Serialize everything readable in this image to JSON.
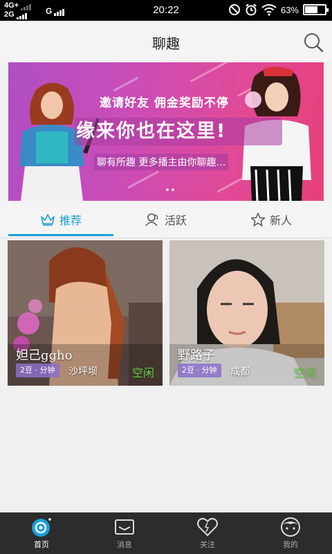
{
  "status_bar": {
    "network_top": "4G+",
    "network_bottom": "2G",
    "network_g": "G",
    "time": "20:22",
    "battery": "63%",
    "battery_level": 0.63
  },
  "header": {
    "title": "聊趣",
    "search_icon": "search-icon"
  },
  "banner": {
    "line1": "邀请好友  佣金奖励不停",
    "line2": "缘来你也在这里!",
    "line3": "聊有所趣 更多播主由你聊趣…",
    "colors": {
      "from": "#b04fc4",
      "to": "#e8407a"
    }
  },
  "tabs": [
    {
      "label": "推荐",
      "icon": "crown-icon",
      "active": true
    },
    {
      "label": "活跃",
      "icon": "users-icon",
      "active": false
    },
    {
      "label": "新人",
      "icon": "star-icon",
      "active": false
    }
  ],
  "cards": [
    {
      "name": "妲己ggho",
      "price": "2豆 · 分钟",
      "location": "沙坪坝",
      "status": "空闲"
    },
    {
      "name": "野路子",
      "price": "2豆 · 分钟",
      "location": "成都",
      "status": "空闲"
    }
  ],
  "bottom_nav": [
    {
      "label": "首页",
      "icon": "home-icon",
      "active": true
    },
    {
      "label": "消息",
      "icon": "message-icon",
      "active": false
    },
    {
      "label": "关注",
      "icon": "heart-icon",
      "active": false
    },
    {
      "label": "我的",
      "icon": "profile-icon",
      "active": false
    }
  ],
  "colors": {
    "accent": "#1a9fd9",
    "status_free": "#62d43c",
    "nav_bg": "#2c2c2c"
  }
}
